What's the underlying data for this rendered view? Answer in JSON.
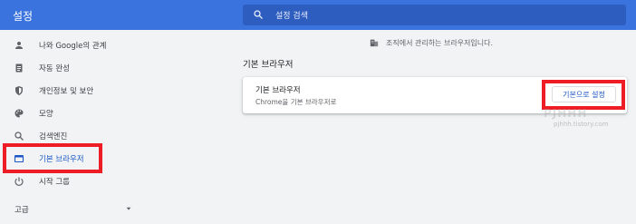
{
  "header": {
    "title": "설정",
    "search_placeholder": "설정 검색"
  },
  "sidebar": {
    "items": [
      {
        "label": "나와 Google의 관계",
        "icon": "person-icon"
      },
      {
        "label": "자동 완성",
        "icon": "clipboard-icon"
      },
      {
        "label": "개인정보 및 보안",
        "icon": "shield-icon"
      },
      {
        "label": "모양",
        "icon": "palette-icon"
      },
      {
        "label": "검색엔진",
        "icon": "search-icon"
      },
      {
        "label": "기본 브라우저",
        "icon": "browser-icon",
        "active": true
      },
      {
        "label": "시작 그룹",
        "icon": "power-icon"
      }
    ],
    "advanced_label": "고급"
  },
  "main": {
    "managed_notice": "조직에서 관리하는 브라우저입니다.",
    "section_title": "기본 브라우저",
    "card": {
      "title": "기본 브라우저",
      "subtitle": "Chrome을 기본 브라우저로",
      "button_label": "기본으로 설정"
    }
  },
  "watermark": {
    "logo_text": "PJHHH",
    "url": "pjhhh.tistory.com"
  },
  "colors": {
    "header_bg": "#3b73de",
    "accent": "#1a56c6",
    "highlight": "#ee1c24"
  }
}
